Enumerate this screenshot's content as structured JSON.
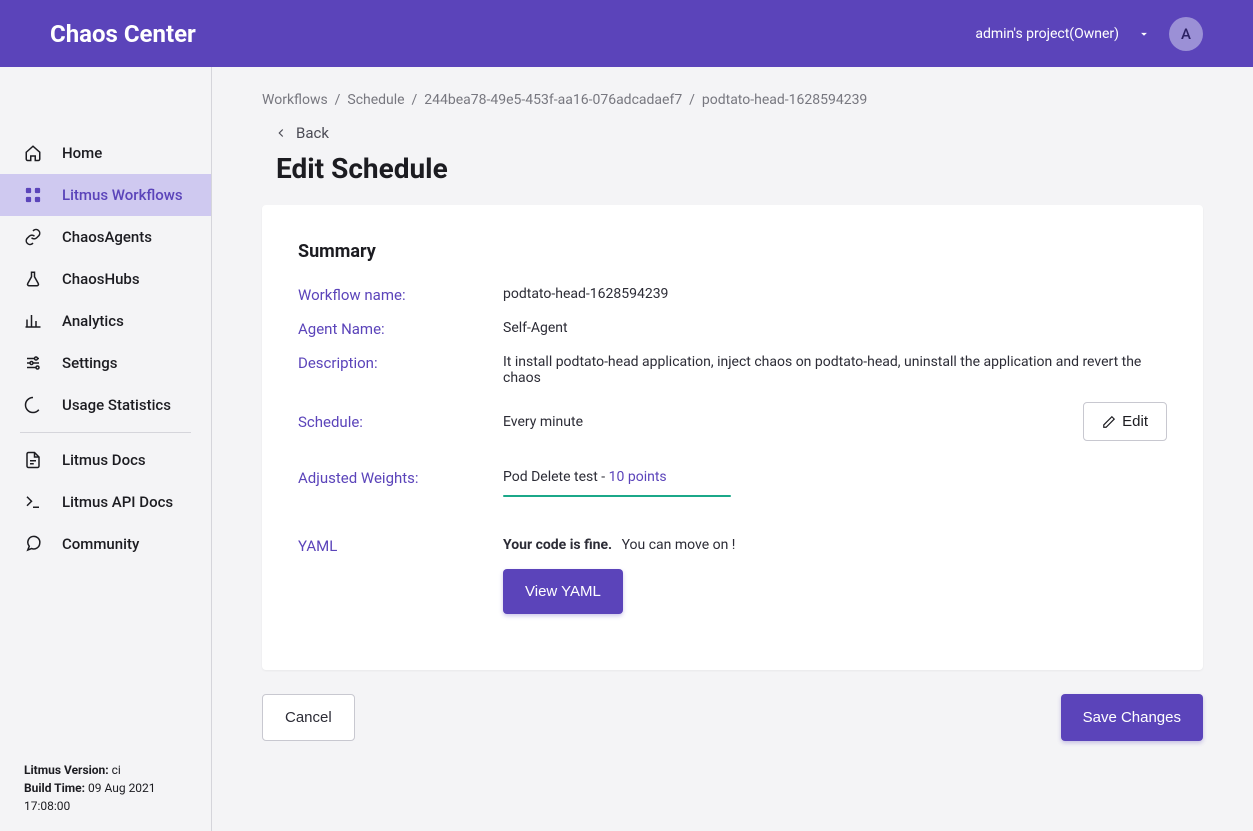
{
  "header": {
    "title": "Chaos Center",
    "project_label": "admin's project(Owner)",
    "avatar_initial": "A"
  },
  "sidebar": {
    "items": [
      {
        "label": "Home"
      },
      {
        "label": "Litmus Workflows"
      },
      {
        "label": "ChaosAgents"
      },
      {
        "label": "ChaosHubs"
      },
      {
        "label": "Analytics"
      },
      {
        "label": "Settings"
      },
      {
        "label": "Usage Statistics"
      },
      {
        "label": "Litmus Docs"
      },
      {
        "label": "Litmus API Docs"
      },
      {
        "label": "Community"
      }
    ],
    "version_label": "Litmus Version:",
    "version_value": " ci",
    "build_label": "Build Time:",
    "build_value": " 09 Aug 2021 17:08:00"
  },
  "breadcrumb": {
    "items": [
      "Workflows",
      "Schedule",
      "244bea78-49e5-453f-aa16-076adcadaef7",
      "podtato-head-1628594239"
    ]
  },
  "back_label": "Back",
  "page_title": "Edit Schedule",
  "summary": {
    "heading": "Summary",
    "labels": {
      "workflow": "Workflow name:",
      "agent": "Agent Name:",
      "description": "Description:",
      "schedule": "Schedule:",
      "weights": "Adjusted Weights:",
      "yaml": "YAML"
    },
    "workflow_name": "podtato-head-1628594239",
    "agent_name": "Self-Agent",
    "description": "It install podtato-head application, inject chaos on podtato-head, uninstall the application and revert the chaos",
    "schedule_value": "Every minute",
    "edit_button": "Edit",
    "weight_test": "Pod Delete test - ",
    "weight_points": "10 points",
    "yaml_status_bold": "Your code is fine.",
    "yaml_status_rest": "You can move on !",
    "view_yaml_button": "View YAML"
  },
  "footer": {
    "cancel": "Cancel",
    "save": "Save Changes"
  }
}
